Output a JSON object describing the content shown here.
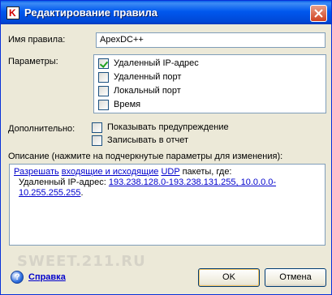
{
  "window": {
    "title": "Редактирование правила",
    "icons": {
      "app": "kaspersky-k-icon",
      "close": "close-x-icon"
    }
  },
  "form": {
    "rule_name_label": "Имя правила:",
    "rule_name_value": "ApexDC++",
    "params_label": "Параметры:",
    "params": [
      {
        "label": "Удаленный IP-адрес",
        "checked": true
      },
      {
        "label": "Удаленный порт",
        "checked": false
      },
      {
        "label": "Локальный порт",
        "checked": false
      },
      {
        "label": "Время",
        "checked": false
      }
    ],
    "additional_label": "Дополнительно:",
    "additional": [
      {
        "label": "Показывать предупреждение",
        "checked": false
      },
      {
        "label": "Записывать в отчет",
        "checked": false
      }
    ],
    "description_label": "Описание (нажмите на подчеркнутые параметры для изменения):",
    "description": {
      "allow": "Разрешать",
      "direction": "входящие и исходящие",
      "protocol": "UDP",
      "packets_text": "пакеты, где:",
      "remote_ip_label": "Удаленный IP-адрес:",
      "remote_ip_value": "193.238.128.0-193.238.131.255, 10.0.0.0-10.255.255.255",
      "period": "."
    }
  },
  "watermark": "SWEET.211.RU",
  "footer": {
    "help_label": "Справка",
    "ok_label": "OK",
    "cancel_label": "Отмена"
  }
}
